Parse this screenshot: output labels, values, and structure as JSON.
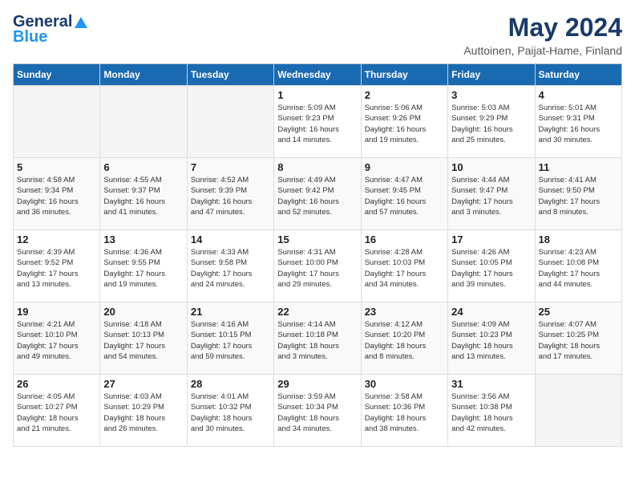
{
  "header": {
    "logo_general": "General",
    "logo_blue": "Blue",
    "month": "May 2024",
    "location": "Auttoinen, Paijat-Hame, Finland"
  },
  "weekdays": [
    "Sunday",
    "Monday",
    "Tuesday",
    "Wednesday",
    "Thursday",
    "Friday",
    "Saturday"
  ],
  "weeks": [
    [
      {
        "day": "",
        "info": ""
      },
      {
        "day": "",
        "info": ""
      },
      {
        "day": "",
        "info": ""
      },
      {
        "day": "1",
        "info": "Sunrise: 5:09 AM\nSunset: 9:23 PM\nDaylight: 16 hours\nand 14 minutes."
      },
      {
        "day": "2",
        "info": "Sunrise: 5:06 AM\nSunset: 9:26 PM\nDaylight: 16 hours\nand 19 minutes."
      },
      {
        "day": "3",
        "info": "Sunrise: 5:03 AM\nSunset: 9:29 PM\nDaylight: 16 hours\nand 25 minutes."
      },
      {
        "day": "4",
        "info": "Sunrise: 5:01 AM\nSunset: 9:31 PM\nDaylight: 16 hours\nand 30 minutes."
      }
    ],
    [
      {
        "day": "5",
        "info": "Sunrise: 4:58 AM\nSunset: 9:34 PM\nDaylight: 16 hours\nand 36 minutes."
      },
      {
        "day": "6",
        "info": "Sunrise: 4:55 AM\nSunset: 9:37 PM\nDaylight: 16 hours\nand 41 minutes."
      },
      {
        "day": "7",
        "info": "Sunrise: 4:52 AM\nSunset: 9:39 PM\nDaylight: 16 hours\nand 47 minutes."
      },
      {
        "day": "8",
        "info": "Sunrise: 4:49 AM\nSunset: 9:42 PM\nDaylight: 16 hours\nand 52 minutes."
      },
      {
        "day": "9",
        "info": "Sunrise: 4:47 AM\nSunset: 9:45 PM\nDaylight: 16 hours\nand 57 minutes."
      },
      {
        "day": "10",
        "info": "Sunrise: 4:44 AM\nSunset: 9:47 PM\nDaylight: 17 hours\nand 3 minutes."
      },
      {
        "day": "11",
        "info": "Sunrise: 4:41 AM\nSunset: 9:50 PM\nDaylight: 17 hours\nand 8 minutes."
      }
    ],
    [
      {
        "day": "12",
        "info": "Sunrise: 4:39 AM\nSunset: 9:52 PM\nDaylight: 17 hours\nand 13 minutes."
      },
      {
        "day": "13",
        "info": "Sunrise: 4:36 AM\nSunset: 9:55 PM\nDaylight: 17 hours\nand 19 minutes."
      },
      {
        "day": "14",
        "info": "Sunrise: 4:33 AM\nSunset: 9:58 PM\nDaylight: 17 hours\nand 24 minutes."
      },
      {
        "day": "15",
        "info": "Sunrise: 4:31 AM\nSunset: 10:00 PM\nDaylight: 17 hours\nand 29 minutes."
      },
      {
        "day": "16",
        "info": "Sunrise: 4:28 AM\nSunset: 10:03 PM\nDaylight: 17 hours\nand 34 minutes."
      },
      {
        "day": "17",
        "info": "Sunrise: 4:26 AM\nSunset: 10:05 PM\nDaylight: 17 hours\nand 39 minutes."
      },
      {
        "day": "18",
        "info": "Sunrise: 4:23 AM\nSunset: 10:08 PM\nDaylight: 17 hours\nand 44 minutes."
      }
    ],
    [
      {
        "day": "19",
        "info": "Sunrise: 4:21 AM\nSunset: 10:10 PM\nDaylight: 17 hours\nand 49 minutes."
      },
      {
        "day": "20",
        "info": "Sunrise: 4:18 AM\nSunset: 10:13 PM\nDaylight: 17 hours\nand 54 minutes."
      },
      {
        "day": "21",
        "info": "Sunrise: 4:16 AM\nSunset: 10:15 PM\nDaylight: 17 hours\nand 59 minutes."
      },
      {
        "day": "22",
        "info": "Sunrise: 4:14 AM\nSunset: 10:18 PM\nDaylight: 18 hours\nand 3 minutes."
      },
      {
        "day": "23",
        "info": "Sunrise: 4:12 AM\nSunset: 10:20 PM\nDaylight: 18 hours\nand 8 minutes."
      },
      {
        "day": "24",
        "info": "Sunrise: 4:09 AM\nSunset: 10:23 PM\nDaylight: 18 hours\nand 13 minutes."
      },
      {
        "day": "25",
        "info": "Sunrise: 4:07 AM\nSunset: 10:25 PM\nDaylight: 18 hours\nand 17 minutes."
      }
    ],
    [
      {
        "day": "26",
        "info": "Sunrise: 4:05 AM\nSunset: 10:27 PM\nDaylight: 18 hours\nand 21 minutes."
      },
      {
        "day": "27",
        "info": "Sunrise: 4:03 AM\nSunset: 10:29 PM\nDaylight: 18 hours\nand 26 minutes."
      },
      {
        "day": "28",
        "info": "Sunrise: 4:01 AM\nSunset: 10:32 PM\nDaylight: 18 hours\nand 30 minutes."
      },
      {
        "day": "29",
        "info": "Sunrise: 3:59 AM\nSunset: 10:34 PM\nDaylight: 18 hours\nand 34 minutes."
      },
      {
        "day": "30",
        "info": "Sunrise: 3:58 AM\nSunset: 10:36 PM\nDaylight: 18 hours\nand 38 minutes."
      },
      {
        "day": "31",
        "info": "Sunrise: 3:56 AM\nSunset: 10:38 PM\nDaylight: 18 hours\nand 42 minutes."
      },
      {
        "day": "",
        "info": ""
      }
    ]
  ]
}
